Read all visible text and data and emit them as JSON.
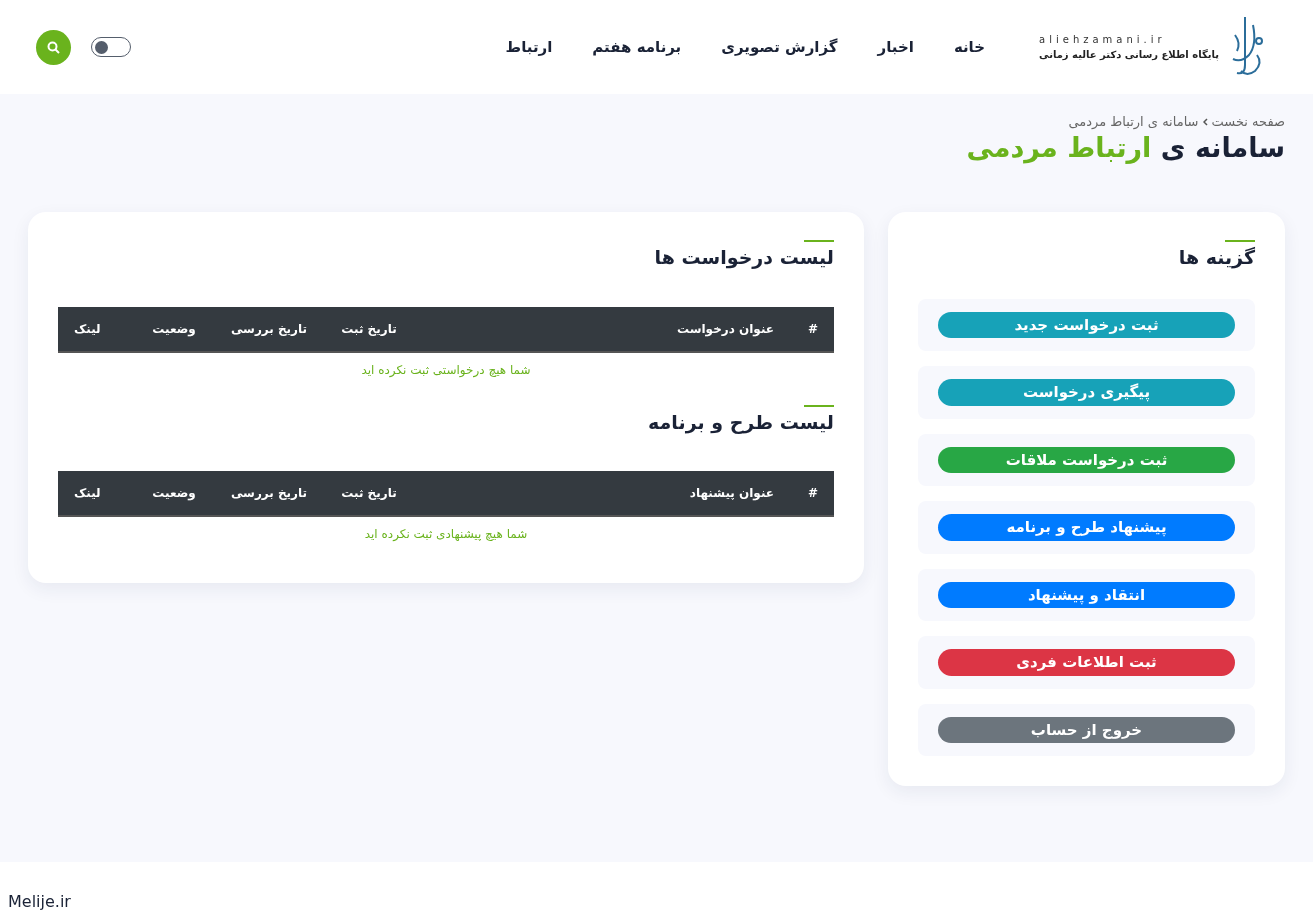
{
  "header": {
    "logo": {
      "domain": "aliehzamani.ir",
      "tagline": "پایگاه اطلاع رسانی دکتر عالیه زمانی"
    },
    "nav": [
      "خانه",
      "اخبار",
      "گزارش تصویری",
      "برنامه هفتم",
      "ارتباط"
    ],
    "theme_switch": {
      "on": false
    }
  },
  "breadcrumb": [
    "صفحه نخست",
    "سامانه ی ارتباط مردمی"
  ],
  "page_title": {
    "main": "سامانه ی",
    "highlight": "ارتباط مردمی"
  },
  "options": {
    "title": "گزینه ها",
    "items": [
      {
        "label": "ثبت درخواست جدید",
        "color": "#17a2b8"
      },
      {
        "label": "پیگیری درخواست",
        "color": "#17a2b8"
      },
      {
        "label": "ثبت درخواست ملاقات",
        "color": "#28a745"
      },
      {
        "label": "پیشنهاد طرح و برنامه",
        "color": "#007bff"
      },
      {
        "label": "انتقاد و پیشنهاد",
        "color": "#007bff"
      },
      {
        "label": "ثبت اطلاعات فردی",
        "color": "#dc3545"
      },
      {
        "label": "خروج از حساب",
        "color": "#6c757d"
      }
    ]
  },
  "lists": [
    {
      "title": "لیست درخواست ها",
      "columns": [
        "#",
        "عنوان درخواست",
        "تاریخ ثبت",
        "تاریخ بررسی",
        "وضعیت",
        "لینک"
      ],
      "empty_message": "شما هیچ درخواستی ثبت نکرده اید"
    },
    {
      "title": "لیست طرح و برنامه",
      "columns": [
        "#",
        "عنوان پیشنهاد",
        "تاریخ ثبت",
        "تاریخ بررسی",
        "وضعیت",
        "لینک"
      ],
      "empty_message": "شما هیچ پیشنهادی ثبت نکرده اید"
    }
  ],
  "footer": {
    "text": "Melije.ir"
  }
}
